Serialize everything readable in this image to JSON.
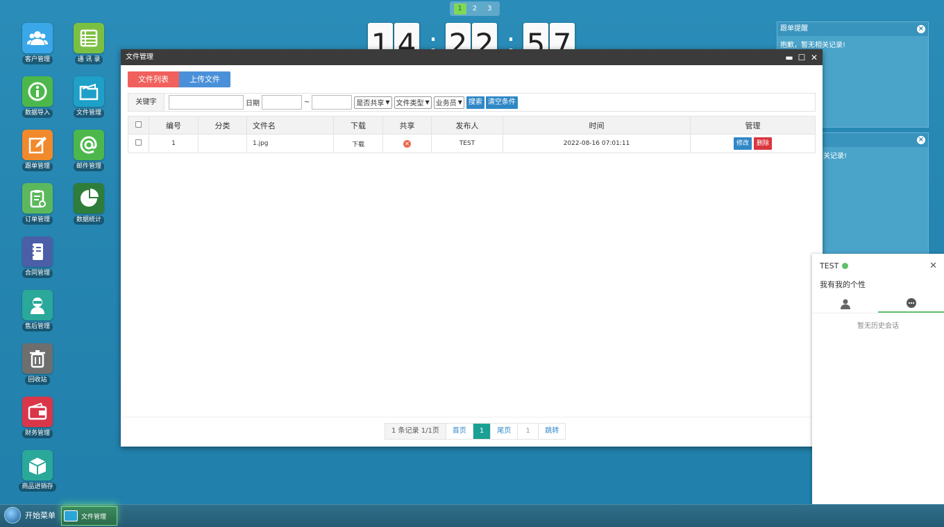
{
  "desktop": {
    "pages": [
      "1",
      "2",
      "3"
    ],
    "clock": {
      "h1": "1",
      "h2": "4",
      "m1": "2",
      "m2": "2",
      "s1": "5",
      "s2": "7",
      "sep": ":"
    },
    "icons": [
      {
        "id": "customer",
        "label": "客户管理",
        "color": "#3aa7e8",
        "icon": "users-icon"
      },
      {
        "id": "contacts",
        "label": "通 讯 录",
        "color": "#7cc043",
        "icon": "list-icon"
      },
      {
        "id": "import",
        "label": "数据导入",
        "color": "#4cb84c",
        "icon": "info-icon"
      },
      {
        "id": "files",
        "label": "文件管理",
        "color": "#1ea0c8",
        "icon": "folder-icon"
      },
      {
        "id": "follow",
        "label": "跟单管理",
        "color": "#f08a2c",
        "icon": "edit-icon"
      },
      {
        "id": "mail",
        "label": "邮件管理",
        "color": "#4cb84c",
        "icon": "at-icon"
      },
      {
        "id": "orders",
        "label": "订单管理",
        "color": "#5cb85c",
        "icon": "clipboard-icon"
      },
      {
        "id": "stats",
        "label": "数据统计",
        "color": "#2e7d3a",
        "icon": "pie-icon"
      },
      {
        "id": "contract",
        "label": "合同管理",
        "color": "#4a5fa8",
        "icon": "notebook-icon"
      },
      {
        "id": "aftersale",
        "label": "售后管理",
        "color": "#2aa89a",
        "icon": "support-icon"
      },
      {
        "id": "recycle",
        "label": "回收站",
        "color": "#6e6e6e",
        "icon": "trash-icon"
      },
      {
        "id": "finance",
        "label": "财务管理",
        "color": "#d9364a",
        "icon": "wallet-icon"
      },
      {
        "id": "stock",
        "label": "商品进销存",
        "color": "#2aa89a",
        "icon": "box-icon"
      }
    ]
  },
  "notices": [
    {
      "title": "跟单提醒",
      "body": "抱歉，暂无相关记录!"
    },
    {
      "title": "",
      "body": "关记录!"
    }
  ],
  "window": {
    "title": "文件管理",
    "tabs": {
      "list": "文件列表",
      "upload": "上传文件"
    },
    "filter": {
      "keyword_label": "关键字",
      "date_label": "日期",
      "tilde": "~",
      "shared": "是否共享",
      "file_type": "文件类型",
      "staff": "业务员",
      "search": "搜索",
      "clear": "清空条件"
    },
    "table": {
      "headers": [
        "编号",
        "分类",
        "文件名",
        "下载",
        "共享",
        "发布人",
        "时间",
        "管理"
      ],
      "rows": [
        {
          "id": "1",
          "category": "",
          "filename": "1.jpg",
          "download": "下载",
          "publisher": "TEST",
          "time": "2022-08-16 07:01:11",
          "edit": "修改",
          "delete": "删除"
        }
      ]
    },
    "pager": {
      "info": "1 条记录 1/1页",
      "first": "首页",
      "current": "1",
      "last": "尾页",
      "jump_value": "1",
      "jump": "跳转"
    }
  },
  "taskbar": {
    "start": "开始菜单",
    "task": "文件管理"
  },
  "chat": {
    "name": "TEST",
    "signature": "我有我的个性",
    "empty": "暂无历史会话"
  }
}
